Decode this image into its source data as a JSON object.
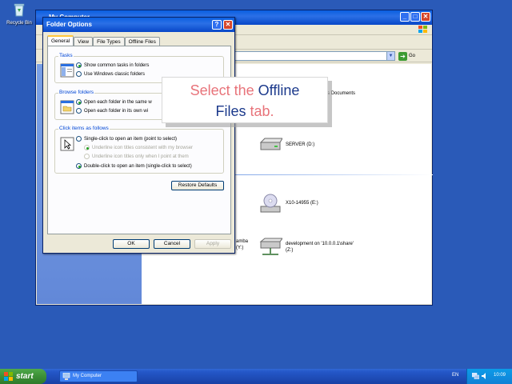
{
  "desktop": {
    "icons": [
      {
        "label": "Recycle Bin",
        "icon": "recycle-bin-icon"
      }
    ]
  },
  "main_window": {
    "title": "My Computer",
    "address_go_label": "Go",
    "groups": [
      {
        "label": "ge"
      }
    ],
    "drives": [
      {
        "label": "s Documents",
        "icon": "folder-icon"
      },
      {
        "label": "SERVER (D:)",
        "icon": "hard-drive-icon"
      },
      {
        "label": "X10-14955 (E:)",
        "icon": "cd-drive-icon"
      },
      {
        "label": "amba\n(Y:)",
        "icon": "network-drive-icon"
      },
      {
        "label": "development on '10.0.0.1\\share'\n(Z:)",
        "icon": "network-drive-icon"
      }
    ]
  },
  "dialog": {
    "title": "Folder Options",
    "help_label": "?",
    "close_label": "✕",
    "tabs": [
      {
        "label": "General",
        "active": true
      },
      {
        "label": "View",
        "active": false
      },
      {
        "label": "File Types",
        "active": false
      },
      {
        "label": "Offline Files",
        "active": false
      }
    ],
    "tasks": {
      "title": "Tasks",
      "options": [
        {
          "label": "Show common tasks in folders",
          "selected": true
        },
        {
          "label": "Use Windows classic folders",
          "selected": false
        }
      ]
    },
    "browse": {
      "title": "Browse folders",
      "options": [
        {
          "label": "Open each folder in the same w",
          "selected": true
        },
        {
          "label": "Open each folder in its own wi",
          "selected": false
        }
      ]
    },
    "click": {
      "title": "Click items as follows",
      "options": [
        {
          "label": "Single-click to open an item (point to select)",
          "selected": false,
          "disabled": false
        },
        {
          "label": "Underline icon titles consistent with my browser",
          "selected": true,
          "disabled": true
        },
        {
          "label": "Underline icon titles only when I point at them",
          "selected": false,
          "disabled": true
        },
        {
          "label": "Double-click to open an item (single-click to select)",
          "selected": true,
          "disabled": false
        }
      ]
    },
    "restore_defaults_label": "Restore Defaults",
    "ok_label": "OK",
    "cancel_label": "Cancel",
    "apply_label": "Apply"
  },
  "callout": {
    "part1": "Select the ",
    "part2": "Offline",
    "part3": "Files",
    "part4": " tab."
  },
  "taskbar": {
    "start_label": "start",
    "task_label": "My Computer",
    "language": "EN",
    "clock": "10:09"
  },
  "colors": {
    "desktop": "#2a5ab8",
    "titlebar": "#0a5fe0",
    "callout_pink": "#e8737a",
    "callout_blue": "#1c3a8c",
    "start_green": "#3c8f36"
  }
}
